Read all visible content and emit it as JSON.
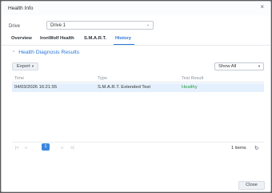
{
  "window": {
    "title": "Health Info"
  },
  "drive": {
    "label": "Drive",
    "selected": "Drive 1"
  },
  "tabs": [
    {
      "label": "Overview"
    },
    {
      "label": "IronWolf Health"
    },
    {
      "label": "S.M.A.R.T."
    },
    {
      "label": "History"
    }
  ],
  "section": {
    "title": "Health Diagnosis Results"
  },
  "toolbar": {
    "export_label": "Export",
    "filter_selected": "Show All"
  },
  "table": {
    "headers": [
      "Time",
      "Type",
      "Test Result"
    ],
    "rows": [
      {
        "time": "04/03/2026 16:21:55",
        "type": "S.M.A.R.T. Extended Test",
        "result": "Healthy"
      }
    ]
  },
  "pager": {
    "current_page": "1",
    "items_text": "1 items"
  },
  "footer": {
    "close_label": "Close"
  },
  "colors": {
    "accent": "#2d77d8",
    "healthy": "#2aa04a",
    "selected_row": "#e4f0fd"
  }
}
